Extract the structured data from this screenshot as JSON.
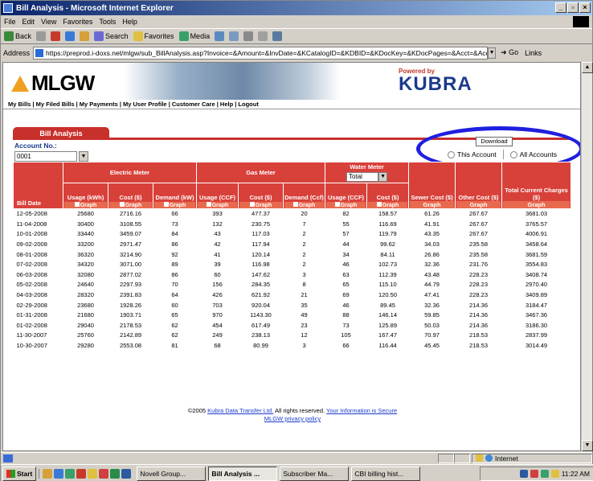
{
  "window": {
    "title": "Bill Analysis - Microsoft Internet Explorer"
  },
  "menu": [
    "File",
    "Edit",
    "View",
    "Favorites",
    "Tools",
    "Help"
  ],
  "toolbar": {
    "back": "Back",
    "search": "Search",
    "favorites": "Favorites",
    "media": "Media"
  },
  "address": {
    "label": "Address",
    "url": "https://preprod.i-doxs.net/mlgw/sub_BillAnalysis.asp?Invoice=&Amount=&InvDate=&KCatalogID=&KDBID=&KDocKey=&KDocPages=&Acct=&Acco",
    "go": "Go",
    "links": "Links"
  },
  "site": {
    "logo": "MLGW",
    "powered_by": "Powered by",
    "kubra": "KUBRA",
    "nav": "My Bills | My Filed Bills | My Payments | My User Profile | Customer Care | Help | Logout"
  },
  "page": {
    "tab": "Bill Analysis",
    "account_label": "Account No.:",
    "account_value": "0001",
    "download": "Download",
    "radio_this": "This Account",
    "radio_all": "All Accounts"
  },
  "table": {
    "groups": {
      "electric": "Electric Meter",
      "gas": "Gas Meter",
      "water": "Water Meter",
      "water_select": "Total"
    },
    "graph_label": "Graph",
    "headers": {
      "bill_date": "Bill Date",
      "e_usage": "Usage (kWh)",
      "e_cost": "Cost ($)",
      "e_demand": "Demand (kW)",
      "g_usage": "Usage (CCF)",
      "g_cost": "Cost ($)",
      "g_demand": "Demand (Ccf)",
      "w_usage": "Usage (CCF)",
      "w_cost": "Cost ($)",
      "sewer": "Sewer Cost ($)",
      "other": "Other Cost ($)",
      "total": "Total Current Charges ($)"
    },
    "rows": [
      [
        "12-05-2008",
        "25680",
        "2716.16",
        "66",
        "393",
        "477.37",
        "20",
        "82",
        "158.57",
        "61.26",
        "267.67",
        "3681.03"
      ],
      [
        "11-04-2008",
        "30400",
        "3108.55",
        "73",
        "132",
        "230.75",
        "7",
        "55",
        "116.69",
        "41.91",
        "267.67",
        "3765.57"
      ],
      [
        "10-01-2008",
        "33440",
        "3459.07",
        "84",
        "43",
        "117.03",
        "2",
        "57",
        "119.79",
        "43.35",
        "267.67",
        "4006.91"
      ],
      [
        "09-02-2008",
        "33200",
        "2971.47",
        "86",
        "42",
        "117.94",
        "2",
        "44",
        "99.62",
        "34.03",
        "235.58",
        "3458.64"
      ],
      [
        "08-01-2008",
        "36320",
        "3214.90",
        "92",
        "41",
        "120.14",
        "2",
        "34",
        "84.11",
        "26.86",
        "235.58",
        "3681.59"
      ],
      [
        "07-02-2008",
        "34320",
        "3071.00",
        "89",
        "39",
        "116.98",
        "2",
        "46",
        "102.73",
        "32.36",
        "231.76",
        "3554.83"
      ],
      [
        "06-03-2008",
        "32080",
        "2877.02",
        "86",
        "60",
        "147.62",
        "3",
        "63",
        "112.39",
        "43.48",
        "228.23",
        "3408.74"
      ],
      [
        "05-02-2008",
        "24640",
        "2297.93",
        "70",
        "156",
        "284.35",
        "8",
        "65",
        "115.10",
        "44.79",
        "228.23",
        "2970.40"
      ],
      [
        "04-03-2008",
        "28320",
        "2391.83",
        "64",
        "426",
        "621.92",
        "21",
        "69",
        "120.50",
        "47.41",
        "228.23",
        "3409.89"
      ],
      [
        "02-29-2008",
        "23680",
        "1928.26",
        "60",
        "703",
        "920.04",
        "35",
        "46",
        "89.45",
        "32.36",
        "214.36",
        "3184.47"
      ],
      [
        "01-31-2008",
        "21680",
        "1903.71",
        "65",
        "970",
        "1143.30",
        "49",
        "88",
        "146.14",
        "59.85",
        "214.36",
        "3467.36"
      ],
      [
        "01-02-2008",
        "29040",
        "2178.53",
        "62",
        "454",
        "617.49",
        "23",
        "73",
        "125.89",
        "50.03",
        "214.36",
        "3186.30"
      ],
      [
        "11-30-2007",
        "25760",
        "2142.89",
        "62",
        "249",
        "238.13",
        "12",
        "105",
        "167.47",
        "70.97",
        "218.53",
        "2837.99"
      ],
      [
        "10-30-2007",
        "29280",
        "2553.08",
        "81",
        "68",
        "80.99",
        "3",
        "66",
        "116.44",
        "45.45",
        "218.53",
        "3014.49"
      ]
    ]
  },
  "footer": {
    "copyright_pre": "©2005",
    "kubra_link": "Kubra Data Transfer Ltd.",
    "rights": "All rights reserved.",
    "secure_link": "Your Information is Secure",
    "privacy_link": "MLGW privacy policy"
  },
  "status": {
    "zone": "Internet"
  },
  "taskbar": {
    "start": "Start",
    "tasks": [
      "Novell Group...",
      "Bill Analysis ...",
      "Subscriber Ma...",
      "CBI billing hist..."
    ],
    "time": "11:22 AM"
  },
  "colors": {
    "header_red": "#d8413a",
    "annotation_blue": "#1f1fe0",
    "titlebar": "#0a246a"
  }
}
